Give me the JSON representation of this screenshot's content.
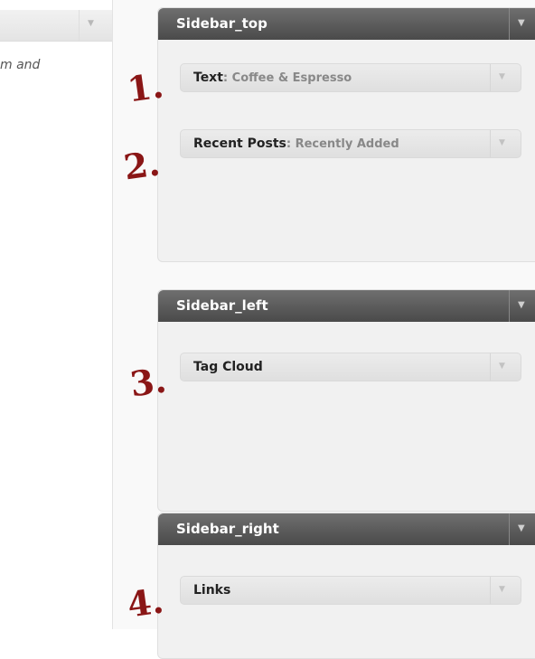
{
  "left_panel": {
    "partial_text": "m and"
  },
  "sidebars": [
    {
      "title": "Sidebar_top",
      "widgets": [
        {
          "name": "Text",
          "sub": "Coffee & Espresso"
        },
        {
          "name": "Recent Posts",
          "sub": "Recently Added"
        }
      ]
    },
    {
      "title": "Sidebar_left",
      "widgets": [
        {
          "name": "Tag Cloud"
        }
      ]
    },
    {
      "title": "Sidebar_right",
      "widgets": [
        {
          "name": "Links"
        }
      ]
    }
  ],
  "annotations": [
    "1.",
    "2.",
    "3.",
    "4."
  ],
  "separator": ": ",
  "icons": {
    "expand": "triangle-down-icon"
  },
  "colors": {
    "header": "#555555",
    "annotation": "#8a1616",
    "widget_bg": "#e6e6e6"
  }
}
